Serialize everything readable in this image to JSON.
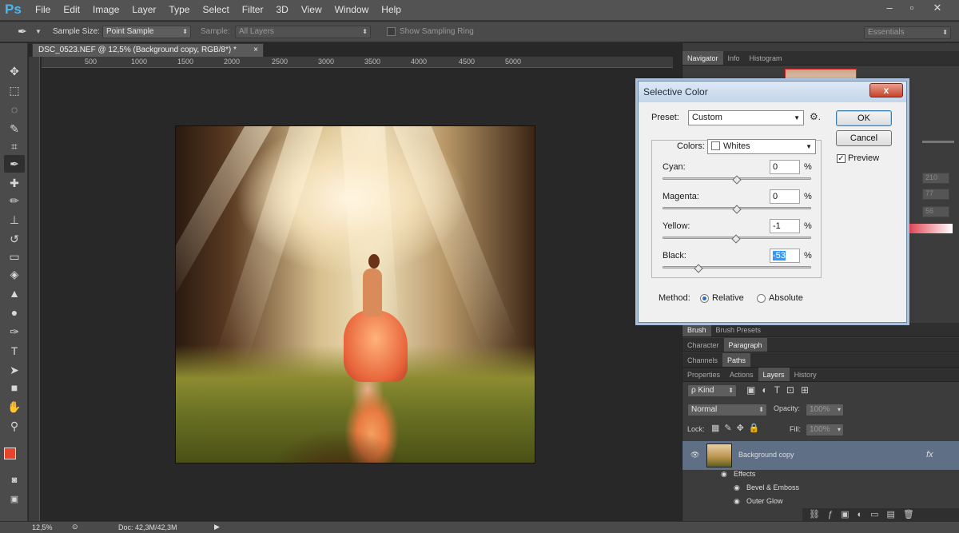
{
  "app": {
    "logo": "Ps"
  },
  "menus": [
    "File",
    "Edit",
    "Image",
    "Layer",
    "Type",
    "Select",
    "Filter",
    "3D",
    "View",
    "Window",
    "Help"
  ],
  "window_controls": [
    "–",
    "▫",
    "✕"
  ],
  "options": {
    "sample_size_label": "Sample Size:",
    "sample_size_value": "Point Sample",
    "sample_label": "Sample:",
    "sample_value": "All Layers",
    "show_ring_label": "Show Sampling Ring",
    "workspace": "Essentials"
  },
  "document": {
    "tab_title": "DSC_0523.NEF @ 12,5% (Background copy, RGB/8*) *",
    "ruler_ticks": [
      "500",
      "1000",
      "1500",
      "2000",
      "2500",
      "3000",
      "3500",
      "4000",
      "4500",
      "5000"
    ]
  },
  "panels": {
    "top_tabs": [
      "Navigator",
      "Info",
      "Histogram"
    ],
    "info_values": [
      "210",
      "77",
      "56"
    ],
    "brush_tabs": [
      "Brush",
      "Brush Presets"
    ],
    "char_tabs": [
      "Character",
      "Paragraph"
    ],
    "channel_tabs": [
      "Channels",
      "Paths"
    ],
    "layer_tabs": [
      "Properties",
      "Actions",
      "Layers",
      "History"
    ],
    "kind_label": "ρ Kind",
    "blend_mode": "Normal",
    "opacity_label": "Opacity:",
    "opacity_value": "100%",
    "lock_label": "Lock:",
    "fill_label": "Fill:",
    "fill_value": "100%",
    "layers": {
      "main": "Background copy",
      "fx": "fx",
      "effects": "Effects",
      "effect1": "Bevel & Emboss",
      "effect2": "Outer Glow"
    }
  },
  "status": {
    "zoom": "12,5%",
    "doc": "Doc: 42,3M/42,3M"
  },
  "dialog": {
    "title": "Selective Color",
    "close": "x",
    "preset_label": "Preset:",
    "preset_value": "Custom",
    "ok": "OK",
    "cancel": "Cancel",
    "preview_label": "Preview",
    "colors_label": "Colors:",
    "colors_value": "Whites",
    "sliders": [
      {
        "label": "Cyan:",
        "value": "0",
        "unit": "%"
      },
      {
        "label": "Magenta:",
        "value": "0",
        "unit": "%"
      },
      {
        "label": "Yellow:",
        "value": "-1",
        "unit": "%"
      },
      {
        "label": "Black:",
        "value": "-53",
        "unit": "%"
      }
    ],
    "method_label": "Method:",
    "relative": "Relative",
    "absolute": "Absolute"
  }
}
